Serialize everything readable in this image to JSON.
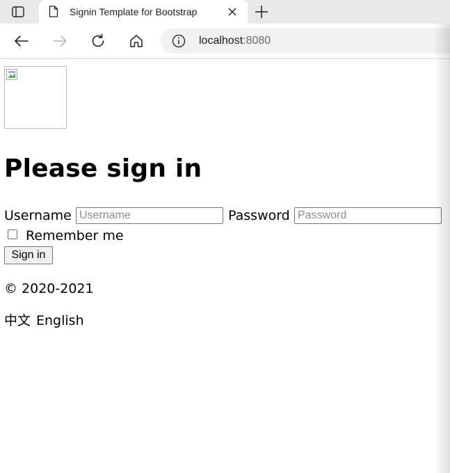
{
  "browser": {
    "tab": {
      "title": "Signin Template for Bootstrap",
      "favicon": "page-icon",
      "close_icon": "close-icon"
    },
    "new_tab_icon": "plus-icon",
    "tab_actions_icon": "tab-actions-icon",
    "nav": {
      "back_icon": "back-arrow-icon",
      "forward_icon": "forward-arrow-icon",
      "reload_icon": "reload-icon",
      "home_icon": "home-icon"
    },
    "address": {
      "info_icon": "info-icon",
      "host": "localhost",
      "port": ":8080"
    }
  },
  "page": {
    "broken_image_icon": "broken-image-icon",
    "heading": "Please sign in",
    "username": {
      "label": "Username",
      "placeholder": "Username",
      "value": ""
    },
    "password": {
      "label": "Password",
      "placeholder": "Password",
      "value": ""
    },
    "remember_me": {
      "label": "Remember me",
      "checked": false
    },
    "submit_label": "Sign in",
    "copyright": "© 2020-2021",
    "languages": [
      "中文",
      "English"
    ]
  },
  "colors": {
    "tabstrip_bg": "#e8e8e8",
    "address_bg": "#f1f1f1",
    "button_bg": "#efefef",
    "border": "#767676"
  }
}
